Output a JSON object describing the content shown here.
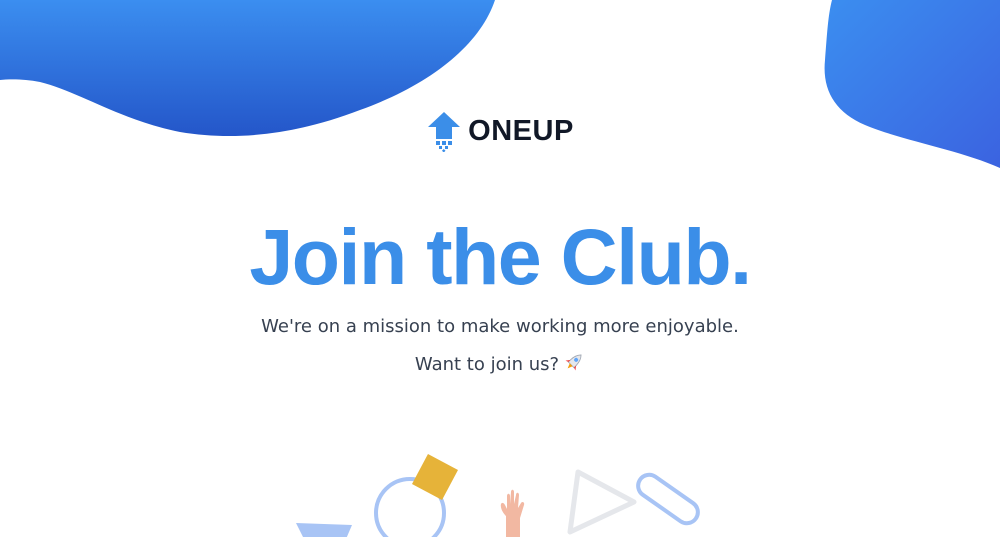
{
  "brand": {
    "name": "ONEUP",
    "logo_icon": "oneup-arrow-logo-icon",
    "colors": {
      "logo_blue": "#3b8ee8",
      "wordmark": "#111827"
    }
  },
  "hero": {
    "headline": "Join the Club.",
    "subtitle_line1": "We're on a mission to make working more enjoyable.",
    "subtitle_line2": "Want to join us?",
    "emoji_icon": "rocket-icon"
  },
  "theme": {
    "accent": "#3b8ee8",
    "blob_gradient": [
      "#3b8ef0",
      "#2456c9"
    ],
    "text": "#374151",
    "background": "#ffffff"
  },
  "decorations": {
    "icons": [
      "trapezoid-shape-icon",
      "ring-shape-icon",
      "square-shape-icon",
      "waving-hand-icon",
      "triangle-shape-icon",
      "pill-shape-icon"
    ],
    "colors": {
      "light_blue": "#a8c4f5",
      "yellow": "#e6b339",
      "skin": "#f2b8a2",
      "outline_gray": "#e5e7eb"
    }
  }
}
